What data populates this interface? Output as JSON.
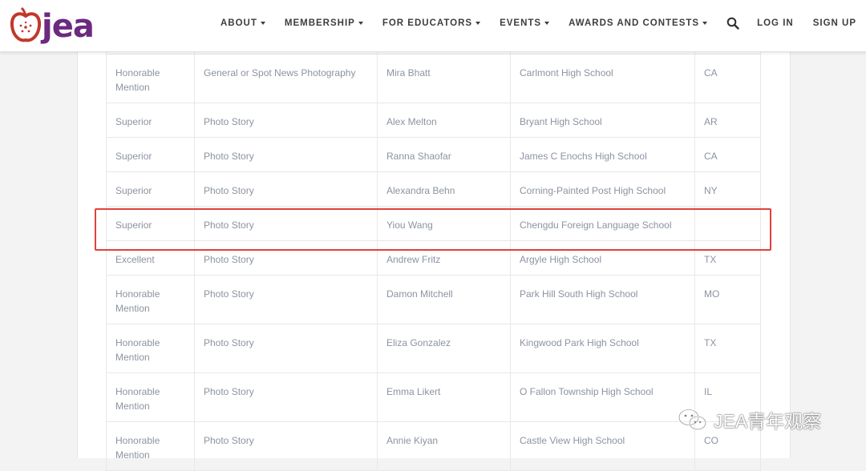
{
  "brand": {
    "logo_text": "jea",
    "brand_color": "#6b2a7f",
    "apple_color": "#c0392b"
  },
  "nav": {
    "items": [
      {
        "label": "ABOUT",
        "dropdown": true
      },
      {
        "label": "MEMBERSHIP",
        "dropdown": true
      },
      {
        "label": "FOR EDUCATORS",
        "dropdown": true
      },
      {
        "label": "EVENTS",
        "dropdown": true
      },
      {
        "label": "AWARDS AND CONTESTS",
        "dropdown": true
      }
    ],
    "search_icon": "search-icon",
    "login": "LOG IN",
    "signup": "SIGN UP"
  },
  "awards_table": {
    "rows": [
      {
        "rating": "Honorable Mention",
        "category": "General or Spot News Photography",
        "name": "Mira Bhatt",
        "school": "Carlmont High School",
        "state": "CA"
      },
      {
        "rating": "Superior",
        "category": "Photo Story",
        "name": "Alex Melton",
        "school": "Bryant High School",
        "state": "AR"
      },
      {
        "rating": "Superior",
        "category": "Photo Story",
        "name": "Ranna Shaofar",
        "school": "James C Enochs High School",
        "state": "CA"
      },
      {
        "rating": "Superior",
        "category": "Photo Story",
        "name": "Alexandra Behn",
        "school": "Corning-Painted Post High School",
        "state": "NY"
      },
      {
        "rating": "Superior",
        "category": "Photo Story",
        "name": "Yiou Wang",
        "school": "Chengdu Foreign Language School",
        "state": ""
      },
      {
        "rating": "Excellent",
        "category": "Photo Story",
        "name": "Andrew Fritz",
        "school": "Argyle High School",
        "state": "TX"
      },
      {
        "rating": "Honorable Mention",
        "category": "Photo Story",
        "name": "Damon Mitchell",
        "school": "Park Hill South High School",
        "state": "MO"
      },
      {
        "rating": "Honorable Mention",
        "category": "Photo Story",
        "name": "Eliza Gonzalez",
        "school": "Kingwood Park High School",
        "state": "TX"
      },
      {
        "rating": "Honorable Mention",
        "category": "Photo Story",
        "name": "Emma Likert",
        "school": "O Fallon Township High School",
        "state": "IL"
      },
      {
        "rating": "Honorable Mention",
        "category": "Photo Story",
        "name": "Annie Kiyan",
        "school": "Castle View High School",
        "state": "CO"
      }
    ],
    "highlight_color": "#e0413b"
  },
  "watermark": {
    "text": "JEA青年观察",
    "icon": "wechat-icon"
  }
}
